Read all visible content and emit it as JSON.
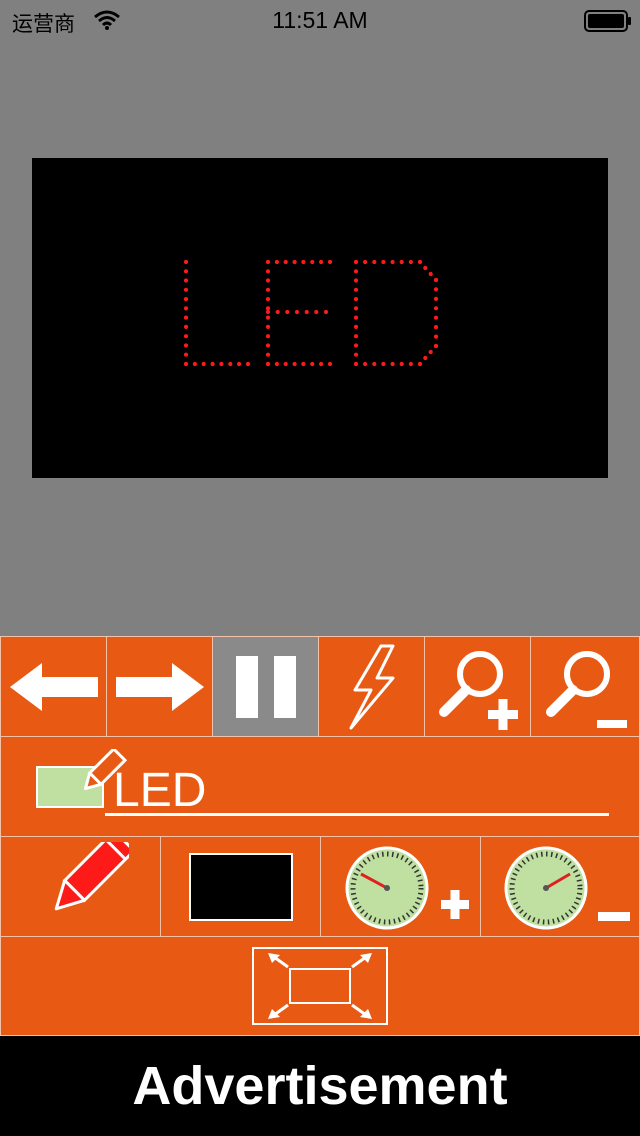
{
  "status_bar": {
    "carrier": "运营商",
    "time": "11:51 AM"
  },
  "led_display": {
    "text": "LED",
    "led_color": "#ff1a1a",
    "background_color": "#000000"
  },
  "toolbar": {
    "buttons": [
      {
        "name": "scroll-left",
        "icon": "arrow-left-icon"
      },
      {
        "name": "scroll-right",
        "icon": "arrow-right-icon"
      },
      {
        "name": "pause",
        "icon": "pause-icon",
        "active": true
      },
      {
        "name": "flash",
        "icon": "lightning-icon"
      },
      {
        "name": "zoom-in",
        "icon": "zoom-in-icon"
      },
      {
        "name": "zoom-out",
        "icon": "zoom-out-icon"
      }
    ]
  },
  "text_input": {
    "value": "LED"
  },
  "settings_row": {
    "buttons": [
      {
        "name": "text-color",
        "icon": "pencil-icon",
        "color": "#ff1a1a"
      },
      {
        "name": "background-color",
        "icon": "color-swatch-icon",
        "color": "#000000"
      },
      {
        "name": "speed-up",
        "icon": "speedometer-plus-icon"
      },
      {
        "name": "speed-down",
        "icon": "speedometer-minus-icon"
      }
    ]
  },
  "fullscreen": {
    "icon": "fullscreen-icon"
  },
  "advertisement": {
    "label": "Advertisement"
  },
  "colors": {
    "panel": "#e85a14",
    "panel_border": "#f3c2a8",
    "active_button": "#8a8a8a",
    "app_background": "#808080"
  }
}
